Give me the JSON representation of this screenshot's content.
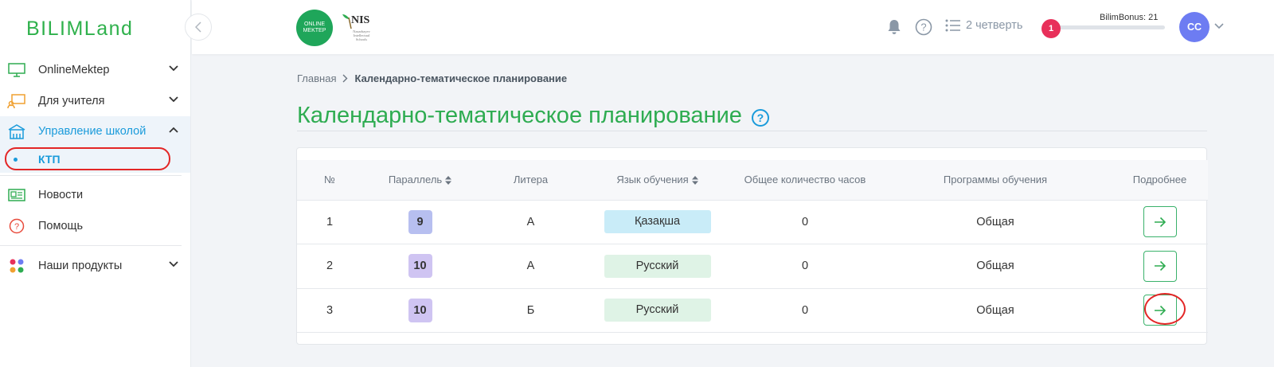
{
  "brand": {
    "logo_text": "BILIMLand",
    "om_logo_line1": "ONLINE",
    "om_logo_line2": "MEKTEP",
    "nis_text": "NIS",
    "nis_sub": "Nazarbayev Intellectual Schools"
  },
  "sidebar": {
    "items": [
      {
        "label": "OnlineMektep",
        "icon": "monitor-icon"
      },
      {
        "label": "Для учителя",
        "icon": "teacher-board-icon"
      },
      {
        "label": "Управление школой",
        "icon": "school-building-icon"
      },
      {
        "label": "Новости",
        "icon": "newspaper-icon"
      },
      {
        "label": "Помощь",
        "icon": "help-circle-icon"
      },
      {
        "label": "Наши продукты",
        "icon": "products-dots-icon"
      }
    ],
    "sub_item": {
      "label": "КТП"
    }
  },
  "header": {
    "quarter": "2 четверть",
    "bonus_label": "BilimBonus: 21",
    "bonus_level": 1,
    "bonus_progress": 0.03,
    "avatar_initials": "СС"
  },
  "breadcrumb": {
    "home": "Главная",
    "current": "Календарно-тематическое планирование"
  },
  "page": {
    "title": "Календарно-тематическое планирование",
    "help": "?"
  },
  "table": {
    "headers": [
      "№",
      "Параллель",
      "Литера",
      "Язык обучения",
      "Общее количество часов",
      "Программы обучения",
      "Подробнее"
    ],
    "rows": [
      {
        "num": "1",
        "parallel": "9",
        "letter": "А",
        "language": "Қазақша",
        "hours": "0",
        "program": "Общая",
        "parallel_color": "#b7bff0",
        "lang_color": "#c9ecf8"
      },
      {
        "num": "2",
        "parallel": "10",
        "letter": "А",
        "language": "Русский",
        "hours": "0",
        "program": "Общая",
        "parallel_color": "#cfc4f2",
        "lang_color": "#dff3e6"
      },
      {
        "num": "3",
        "parallel": "10",
        "letter": "Б",
        "language": "Русский",
        "hours": "0",
        "program": "Общая",
        "parallel_color": "#cfc4f2",
        "lang_color": "#dff3e6"
      }
    ]
  },
  "colors": {
    "brand_green": "#2eac51",
    "active_blue": "#1a9bdb",
    "annotation_red": "#e32626"
  }
}
